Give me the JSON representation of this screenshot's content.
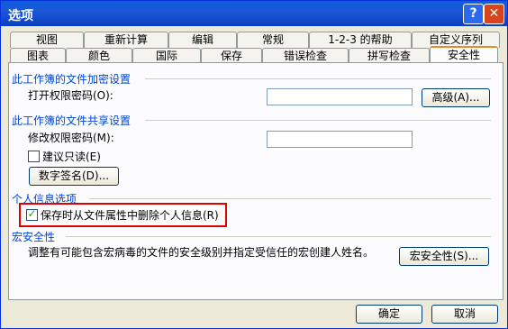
{
  "window": {
    "title": "选项"
  },
  "tabs_top": [
    "视图",
    "重新计算",
    "编辑",
    "常规",
    "1-2-3 的帮助",
    "自定义序列"
  ],
  "tabs_bottom": [
    "图表",
    "颜色",
    "国际",
    "保存",
    "错误检查",
    "拼写检查",
    "安全性"
  ],
  "encrypt": {
    "group": "此工作簿的文件加密设置",
    "open_pwd_label": "打开权限密码(O):",
    "advanced_btn": "高级(A)..."
  },
  "share": {
    "group": "此工作簿的文件共享设置",
    "modify_pwd_label": "修改权限密码(M):",
    "readonly_label": "建议只读(E)",
    "digital_sig_btn": "数字签名(D)..."
  },
  "privacy": {
    "group": "个人信息选项",
    "remove_info_label": "保存时从文件属性中删除个人信息(R)",
    "remove_info_checked": true
  },
  "macro": {
    "group": "宏安全性",
    "desc": "调整有可能包含宏病毒的文件的安全级别并指定受信任的宏创建人姓名。",
    "btn": "宏安全性(S)..."
  },
  "footer": {
    "ok": "确定",
    "cancel": "取消"
  }
}
